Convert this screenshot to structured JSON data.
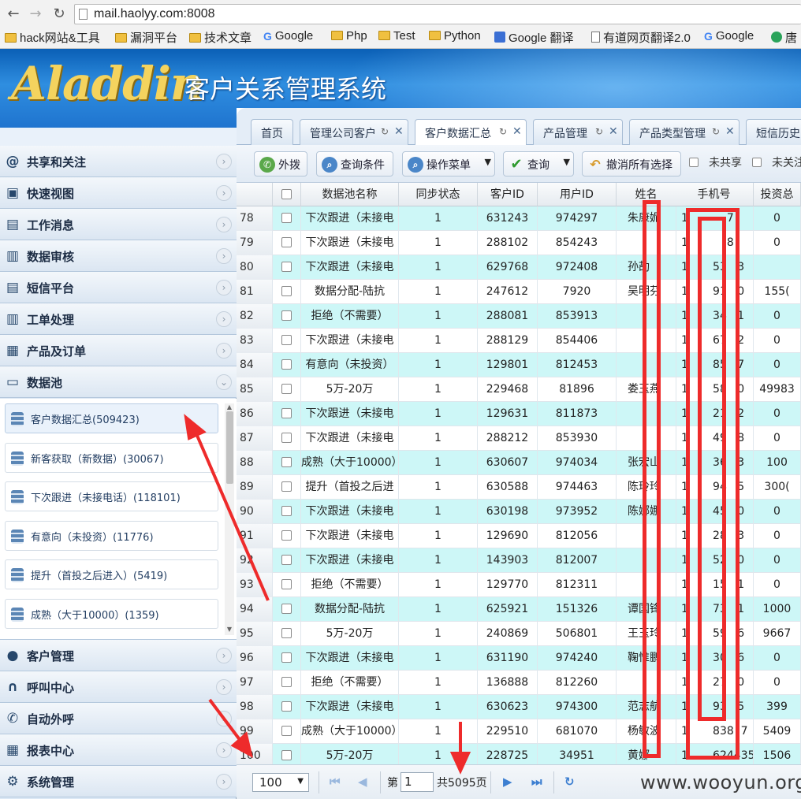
{
  "browser": {
    "url": "mail.haolyy.com:8008",
    "bookmarks": [
      {
        "label": "hack网站&工具",
        "icon": "folder"
      },
      {
        "label": "漏洞平台",
        "icon": "folder"
      },
      {
        "label": "技术文章",
        "icon": "folder"
      },
      {
        "label": "Google",
        "icon": "g"
      },
      {
        "label": "Php",
        "icon": "folder"
      },
      {
        "label": "Test",
        "icon": "folder"
      },
      {
        "label": "Python",
        "icon": "folder"
      },
      {
        "label": "Google 翻译",
        "icon": "tr"
      },
      {
        "label": "有道网页翻译2.0",
        "icon": "doc"
      },
      {
        "label": "Google",
        "icon": "g"
      },
      {
        "label": "唐",
        "icon": "grn"
      }
    ]
  },
  "header": {
    "logo": "Aladdin",
    "title": "客户关系管理系统"
  },
  "sidebar": {
    "sections_top": [
      {
        "label": "共享和关注",
        "icon": "@"
      },
      {
        "label": "快速视图",
        "icon": "▣"
      },
      {
        "label": "工作消息",
        "icon": "▤"
      },
      {
        "label": "数据审核",
        "icon": "▥"
      },
      {
        "label": "短信平台",
        "icon": "▤"
      },
      {
        "label": "工单处理",
        "icon": "▥"
      },
      {
        "label": "产品及订单",
        "icon": "▦"
      },
      {
        "label": "数据池",
        "icon": "▭"
      }
    ],
    "pool_items": [
      {
        "label": "客户数据汇总",
        "count": "(509423)"
      },
      {
        "label": "新客获取（新数据）",
        "count": "(30067)"
      },
      {
        "label": "下次跟进（未接电话）",
        "count": "(118101)"
      },
      {
        "label": "有意向（未投资）",
        "count": "(11776)"
      },
      {
        "label": "提升（首投之后进入）",
        "count": "(5419)"
      },
      {
        "label": "成熟（大于10000）",
        "count": "(1359)"
      }
    ],
    "sections_bottom": [
      {
        "label": "客户管理",
        "icon": "●"
      },
      {
        "label": "呼叫中心",
        "icon": "∩"
      },
      {
        "label": "自动外呼",
        "icon": "✆"
      },
      {
        "label": "报表中心",
        "icon": "▦"
      },
      {
        "label": "系统管理",
        "icon": "⚙"
      }
    ]
  },
  "tabs": [
    {
      "label": "首页",
      "closable": false
    },
    {
      "label": "管理公司客户",
      "closable": true
    },
    {
      "label": "客户数据汇总",
      "closable": true
    },
    {
      "label": "产品管理",
      "closable": true
    },
    {
      "label": "产品类型管理",
      "closable": true
    },
    {
      "label": "短信历史",
      "closable": false
    }
  ],
  "toolbar": {
    "dial": "外拨",
    "query_cond": "查询条件",
    "op_menu": "操作菜单",
    "query": "查询",
    "undo_sel": "撤消所有选择",
    "not_shared": "未共享",
    "not_followed": "未关注"
  },
  "grid": {
    "columns": [
      "数据池名称",
      "同步状态",
      "客户ID",
      "用户ID",
      "姓名",
      "手机号",
      "投资总"
    ],
    "rows": [
      [
        "78",
        "下次跟进（未接电",
        "1",
        "631243",
        "974297",
        "朱康妮",
        "1           7",
        "0"
      ],
      [
        "79",
        "下次跟进（未接电",
        "1",
        "288102",
        "854243",
        "",
        "1           8",
        "0"
      ],
      [
        "80",
        "下次跟进（未接电",
        "1",
        "629768",
        "972408",
        "孙劼",
        "1       53   3",
        ""
      ],
      [
        "81",
        "数据分配-陆抗",
        "1",
        "247612",
        "7920",
        "吴明芬",
        "1       91   0",
        "155("
      ],
      [
        "82",
        "拒绝（不需要）",
        "1",
        "288081",
        "853913",
        "",
        "1       34   1",
        "0"
      ],
      [
        "83",
        "下次跟进（未接电",
        "1",
        "288129",
        "854406",
        "",
        "1       67   2",
        "0"
      ],
      [
        "84",
        "有意向（未投资）",
        "1",
        "129801",
        "812453",
        "",
        "1       85   7",
        "0"
      ],
      [
        "85",
        "5万-20万",
        "1",
        "229468",
        "81896",
        "娄玉燕",
        "1       58   0",
        "49983"
      ],
      [
        "86",
        "下次跟进（未接电",
        "1",
        "129631",
        "811873",
        "",
        "1       21   2",
        "0"
      ],
      [
        "87",
        "下次跟进（未接电",
        "1",
        "288212",
        "853930",
        "",
        "1       49   8",
        "0"
      ],
      [
        "88",
        "成熟（大于10000）",
        "1",
        "630607",
        "974034",
        "张宏山",
        "1       36   3",
        "100"
      ],
      [
        "89",
        "提升（首投之后进",
        "1",
        "630588",
        "974463",
        "陈玲玲",
        "1       94   5",
        "300("
      ],
      [
        "90",
        "下次跟进（未接电",
        "1",
        "630198",
        "973952",
        "陈娜娜",
        "1       45   0",
        "0"
      ],
      [
        "91",
        "下次跟进（未接电",
        "1",
        "129690",
        "812056",
        "",
        "1       28   3",
        "0"
      ],
      [
        "92",
        "下次跟进（未接电",
        "1",
        "143903",
        "812007",
        "",
        "1       52   0",
        "0"
      ],
      [
        "93",
        "拒绝（不需要）",
        "1",
        "129770",
        "812311",
        "",
        "1       15   1",
        "0"
      ],
      [
        "94",
        "数据分配-陆抗",
        "1",
        "625921",
        "151326",
        "谭国锋",
        "1       73   1",
        "1000"
      ],
      [
        "95",
        "5万-20万",
        "1",
        "240869",
        "506801",
        "王玉玲",
        "1       59   6",
        "9667"
      ],
      [
        "96",
        "下次跟进（未接电",
        "1",
        "631190",
        "974240",
        "鞠惟鹏",
        "1       30   6",
        "0"
      ],
      [
        "97",
        "拒绝（不需要）",
        "1",
        "136888",
        "812260",
        "",
        "1       27   0",
        "0"
      ],
      [
        "98",
        "下次跟进（未接电",
        "1",
        "630623",
        "974300",
        "范志航",
        "1       93   5",
        "399"
      ],
      [
        "99",
        "成熟（大于10000）",
        "1",
        "229510",
        "681070",
        "杨敏波",
        "1       838  7",
        "5409"
      ],
      [
        "100",
        "5万-20万",
        "1",
        "228725",
        "34951",
        "黄娜",
        "1       624435 2",
        "1506"
      ]
    ]
  },
  "pager": {
    "page_size": "100",
    "page_label": "第",
    "page_value": "1",
    "total": "共5095页"
  },
  "watermark": "www.wooyun.org",
  "colors": {
    "header_blue": "#1f74cf",
    "row_highlight": "#cdf7f7",
    "annotation_red": "#ee2b2b",
    "pager_blue": "#3d7fd1"
  }
}
